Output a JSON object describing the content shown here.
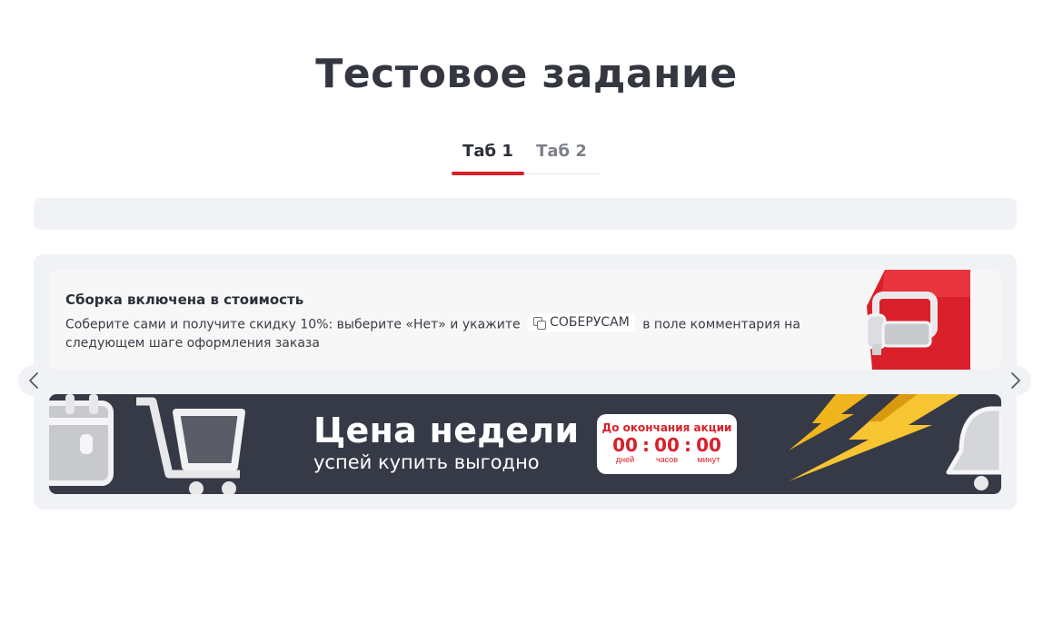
{
  "page": {
    "title": "Тестовое задание"
  },
  "tabs": [
    {
      "label": "Таб 1",
      "active": true
    },
    {
      "label": "Таб 2",
      "active": false
    }
  ],
  "slides": {
    "info_card": {
      "title": "Сборка включена в стоимость",
      "text_before": "Соберите сами и получите скидку 10%: выберите «Нет» и укажите",
      "promo_code": "СОБЕРУСАМ",
      "text_after": "в поле комментария на следующем шаге оформления заказа",
      "icon": "sofa-icon"
    },
    "banner": {
      "title": "Цена недели",
      "subtitle": "успей купить выгодно",
      "countdown": {
        "title": "До окончания акции",
        "days": "00",
        "days_label": "дней",
        "hours": "00",
        "hours_label": "часов",
        "minutes": "00",
        "minutes_label": "минут"
      }
    }
  },
  "colors": {
    "accent": "#d9202a",
    "banner_bg": "#363a46",
    "panel_bg": "#f1f2f6"
  },
  "icons": {
    "prev": "chevron-left-icon",
    "next": "chevron-right-icon",
    "copy": "copy-icon"
  }
}
